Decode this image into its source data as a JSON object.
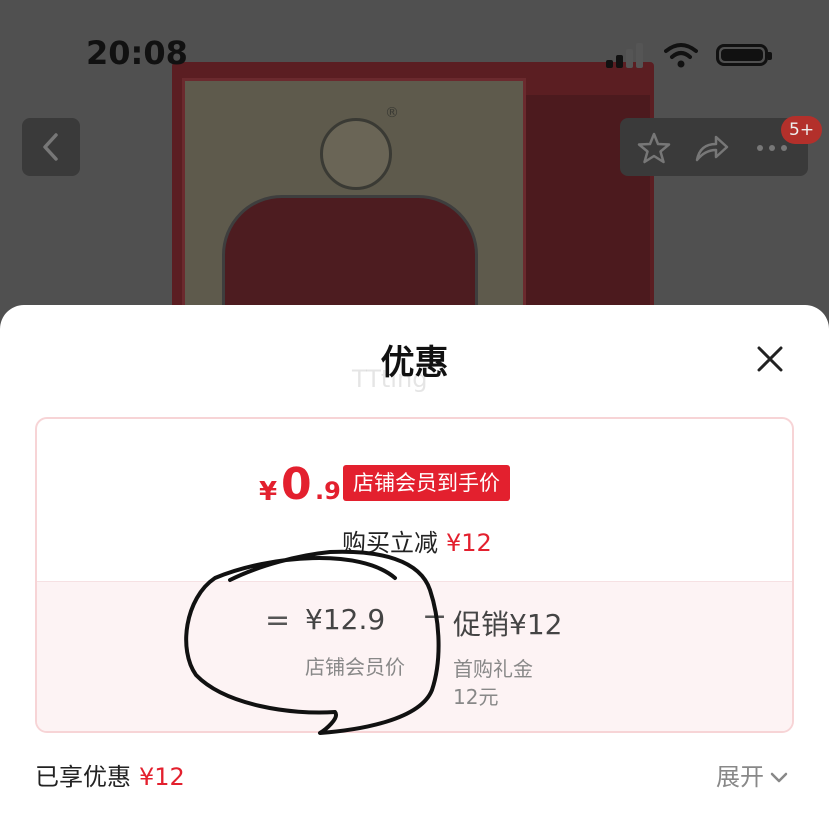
{
  "status_bar": {
    "time": "20:08"
  },
  "top_bar": {
    "badge": "5+"
  },
  "product": {
    "registered_mark": "®"
  },
  "sheet": {
    "title": "优惠",
    "watermark": "TTting",
    "discount_card": {
      "currency": "¥",
      "final_price_int": "0",
      "final_price_dec": ".9",
      "price_tag": "店铺会员到手价",
      "reduce_label": "购买立减",
      "reduce_value": "¥12",
      "equals": "=",
      "member_price": "¥12.9",
      "member_price_label": "店铺会员价",
      "minus": "−",
      "promo": "促销¥12",
      "gift_label": "首购礼金",
      "gift_value": "12元"
    },
    "enjoyed_label": "已享优惠",
    "enjoyed_value": "¥12",
    "expand_label": "展开"
  },
  "colors": {
    "accent": "#e3202e",
    "overlay": "#505050"
  },
  "icons": [
    "back-chevron-icon",
    "star-icon",
    "share-icon",
    "more-icon",
    "close-icon",
    "chevron-down-icon",
    "signal-icon",
    "wifi-icon",
    "battery-icon"
  ]
}
